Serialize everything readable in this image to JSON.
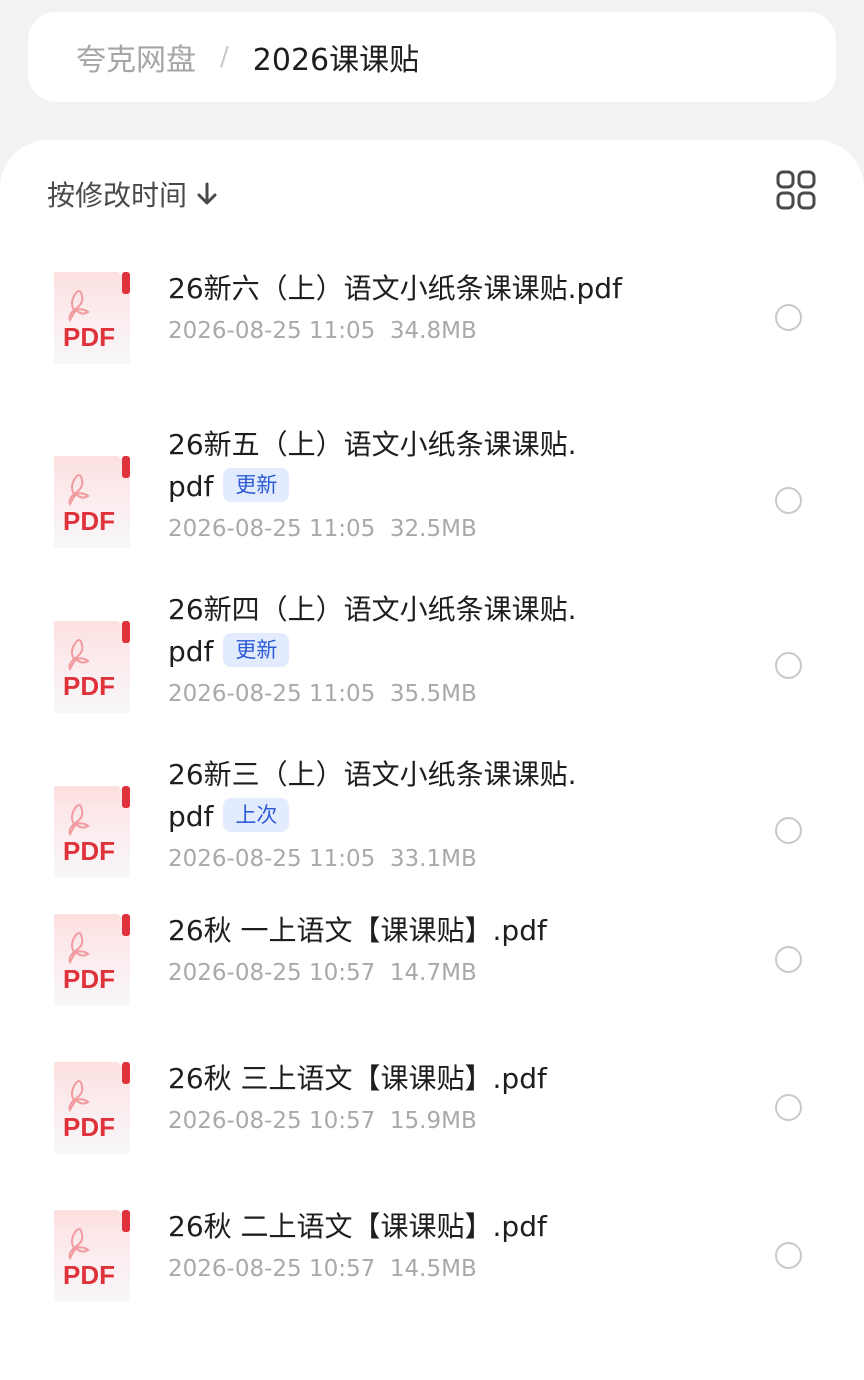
{
  "breadcrumb": {
    "root": "夸克网盘",
    "separator": "/",
    "current": "2026课课贴"
  },
  "toolbar": {
    "sort_label": "按修改时间",
    "sort_icon": "arrow-down-icon",
    "view_toggle_icon": "grid-view-icon"
  },
  "file_icon_text": "PDF",
  "colors": {
    "badge_bg": "#e3ecff",
    "badge_text": "#2d5bd4",
    "pdf_red": "#e0323b"
  },
  "files": [
    {
      "name_line1": "26新六（上）语文小纸条课课贴.pdf",
      "name_line2": "",
      "badge": "",
      "date": "2026-08-25 11:05",
      "size": "34.8MB"
    },
    {
      "name_line1": "26新五（上）语文小纸条课课贴.",
      "name_line2": "pdf",
      "badge": "更新",
      "date": "2026-08-25 11:05",
      "size": "32.5MB"
    },
    {
      "name_line1": "26新四（上）语文小纸条课课贴.",
      "name_line2": "pdf",
      "badge": "更新",
      "date": "2026-08-25 11:05",
      "size": "35.5MB"
    },
    {
      "name_line1": "26新三（上）语文小纸条课课贴.",
      "name_line2": "pdf",
      "badge": "上次",
      "date": "2026-08-25 11:05",
      "size": "33.1MB"
    },
    {
      "name_line1": "26秋 一上语文【课课贴】.pdf",
      "name_line2": "",
      "badge": "",
      "date": "2026-08-25 10:57",
      "size": "14.7MB"
    },
    {
      "name_line1": "26秋 三上语文【课课贴】.pdf",
      "name_line2": "",
      "badge": "",
      "date": "2026-08-25 10:57",
      "size": "15.9MB"
    },
    {
      "name_line1": "26秋 二上语文【课课贴】.pdf",
      "name_line2": "",
      "badge": "",
      "date": "2026-08-25 10:57",
      "size": "14.5MB"
    }
  ]
}
